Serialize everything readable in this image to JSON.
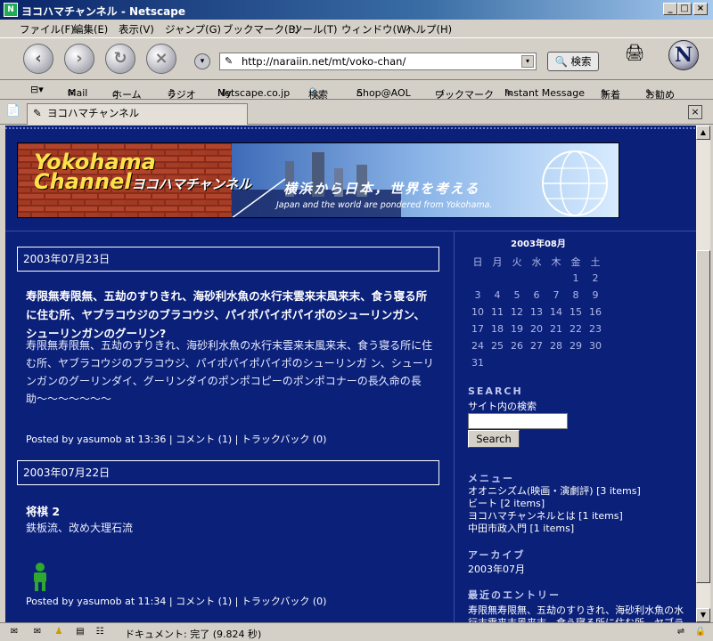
{
  "window": {
    "title": "ヨコハマチャンネル - Netscape"
  },
  "menu": [
    "ファイル(F)",
    "編集(E)",
    "表示(V)",
    "ジャンプ(G)",
    "ブックマーク(B)",
    "ツール(T)",
    "ウィンドウ(W)",
    "ヘルプ(H)"
  ],
  "nav": {
    "url": "http://naraiin.net/mt/voko-chan/",
    "search_label": "検索"
  },
  "personal_toolbar": [
    "Mail",
    "ホーム",
    "ラジオ",
    "Netscape.co.jp",
    "検索",
    "Shop@AOL",
    "ブックマーク",
    "Instant Message",
    "新着",
    "お勧め"
  ],
  "tab": {
    "label": "ヨコハマチャンネル"
  },
  "banner": {
    "logo_line1": "Yokohama",
    "logo_line2": "Channel",
    "logo_jp": "ヨコハマチャンネル",
    "tagline_jp": "横浜から日本，世界を考える",
    "tagline_en": "Japan and the world are pondered from Yokohama."
  },
  "entries": [
    {
      "date": "2003年07月23日",
      "title": "寿限無寿限無、五劫のすりきれ、海砂利水魚の水行末雲来末風来末、食う寝る所に住む所、ヤブラコウジのブラコウジ、パイポパイポパイポのシューリンガン、シューリンガンのグーリン?",
      "body": "寿限無寿限無、五劫のすりきれ、海砂利水魚の水行末雲来末風来末、食う寝る所に住む所、ヤブラコウジのブラコウジ、パイポパイポパイポのシューリンガ ン、シューリンガンのグーリンダイ、グーリンダイのポンポコピーのポンポコナーの長久命の長助〜〜〜〜〜〜〜",
      "posted_by": "Posted by yasumob at 13:36",
      "comments": "コメント (1)",
      "trackback": "トラックバック (0)"
    },
    {
      "date": "2003年07月22日",
      "title": "将棋 2",
      "body": "鉄板流、改め大理石流",
      "posted_by": "Posted by yasumob at 11:34",
      "comments": "コメント (1)",
      "trackback": "トラックバック (0)"
    }
  ],
  "calendar": {
    "month": "2003年08月",
    "weekdays": [
      "日",
      "月",
      "火",
      "水",
      "木",
      "金",
      "土"
    ],
    "weeks": [
      [
        "",
        "",
        "",
        "",
        "",
        "1",
        "2"
      ],
      [
        "3",
        "4",
        "5",
        "6",
        "7",
        "8",
        "9"
      ],
      [
        "10",
        "11",
        "12",
        "13",
        "14",
        "15",
        "16"
      ],
      [
        "17",
        "18",
        "19",
        "20",
        "21",
        "22",
        "23"
      ],
      [
        "24",
        "25",
        "26",
        "27",
        "28",
        "29",
        "30"
      ],
      [
        "31",
        "",
        "",
        "",
        "",
        "",
        ""
      ]
    ]
  },
  "sidebar": {
    "search_heading": "SEARCH",
    "search_label": "サイト内の検索",
    "search_button": "Search",
    "menu_heading": "メニュー",
    "menu_items": [
      "オオニシズム(映画・演劇評) [3 items]",
      "ビート [2 items]",
      "ヨコハマチャンネルとは [1 items]",
      "中田市政入門 [1 items]"
    ],
    "archive_heading": "アーカイブ",
    "archive_items": [
      "2003年07月"
    ],
    "recent_heading": "最近のエントリー",
    "recent_items": [
      "寿限無寿限無、五劫のすりきれ、海砂利水魚の水行末雲来末風来末、食う寝る所に住む所、ヤブラコウジのブラコ"
    ]
  },
  "status": {
    "text": "ドキュメント: 完了 (9.824 秒)"
  }
}
